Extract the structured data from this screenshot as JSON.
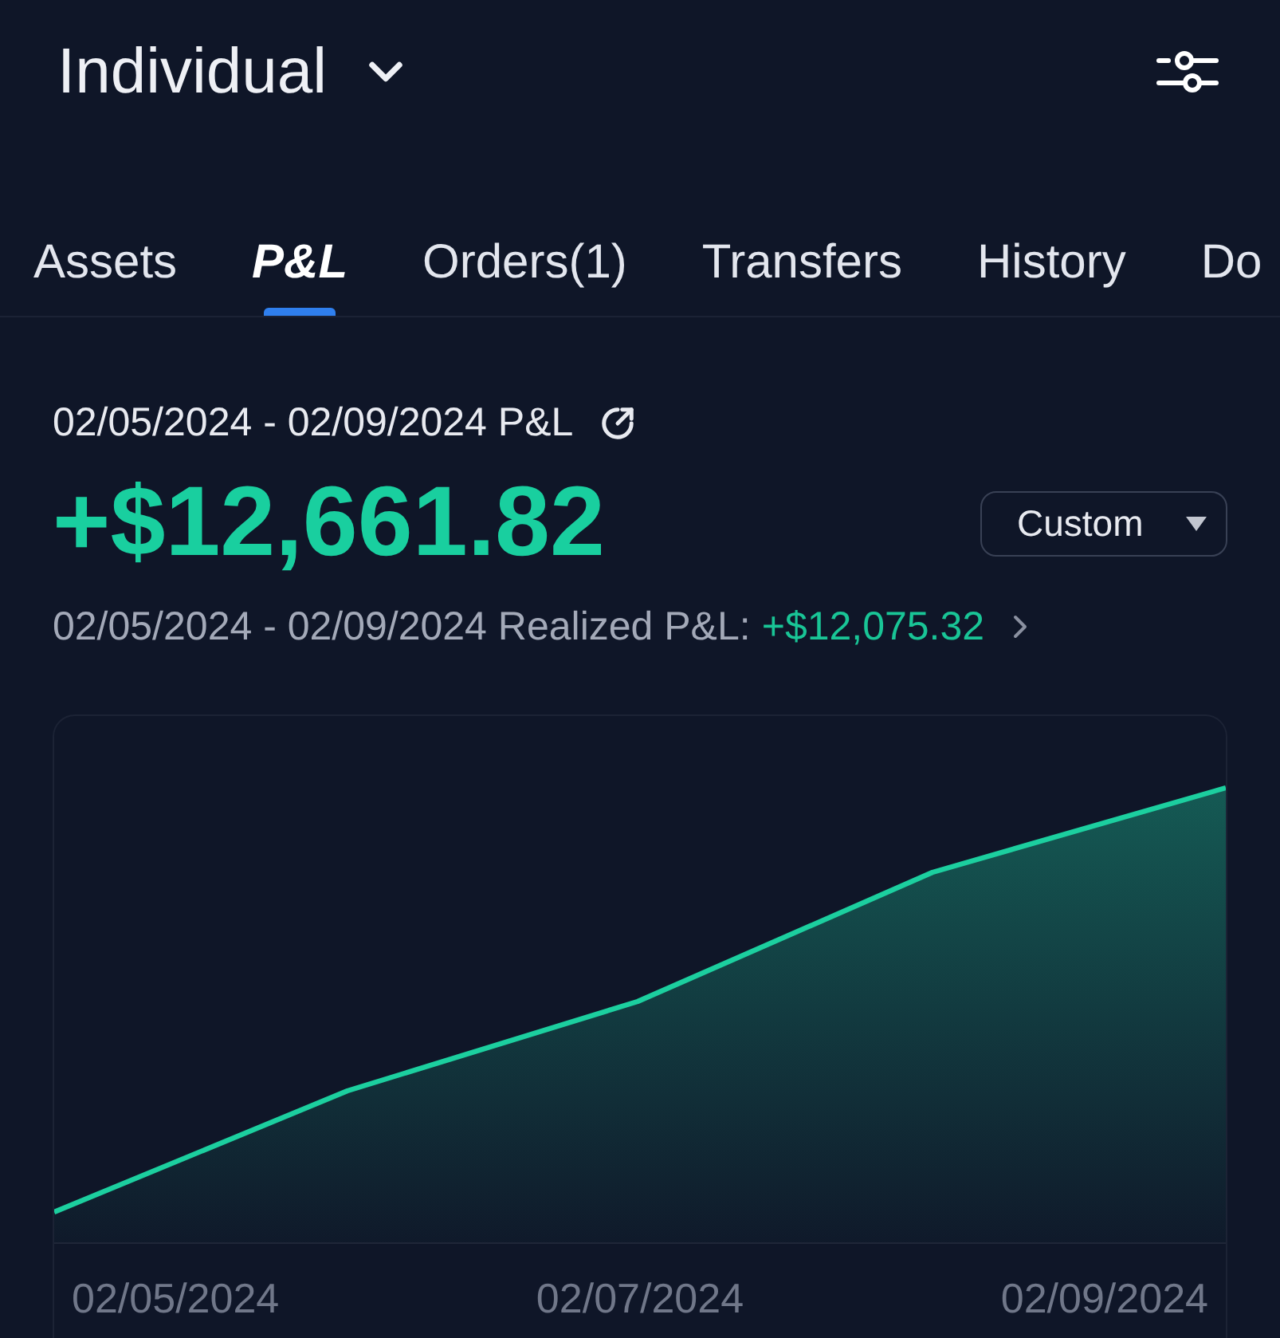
{
  "header": {
    "account": "Individual"
  },
  "tabs": [
    {
      "label": "Assets",
      "selected": false
    },
    {
      "label": "P&L",
      "selected": true
    },
    {
      "label": "Orders(1)",
      "selected": false
    },
    {
      "label": "Transfers",
      "selected": false
    },
    {
      "label": "History",
      "selected": false
    },
    {
      "label": "Do",
      "selected": false
    }
  ],
  "summary": {
    "period_title": "02/05/2024 - 02/09/2024 P&L",
    "total_pnl": "+$12,661.82",
    "range_selector": "Custom",
    "realized_label": "02/05/2024 - 02/09/2024 Realized P&L:",
    "realized_value": "+$12,075.32"
  },
  "chart": {
    "x_labels": [
      "02/05/2024",
      "02/07/2024",
      "02/09/2024"
    ]
  }
}
